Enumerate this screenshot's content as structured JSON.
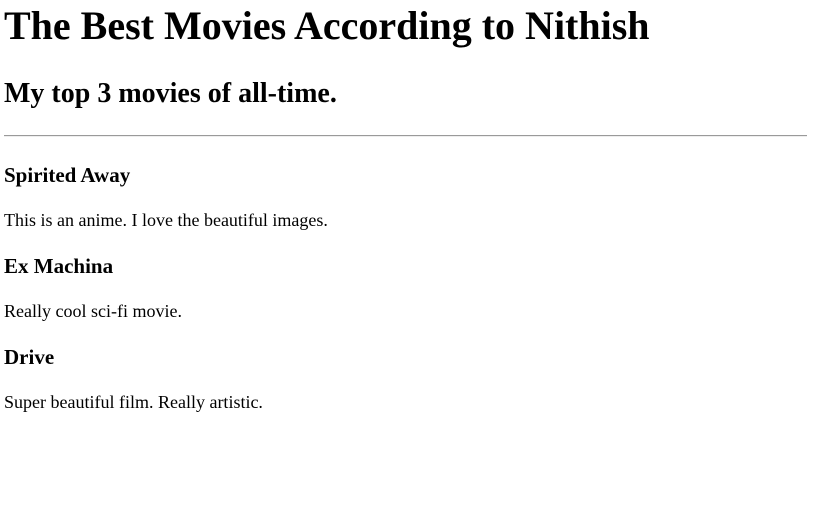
{
  "page": {
    "title": "The Best Movies According to Nithish",
    "subtitle": "My top 3 movies of all-time."
  },
  "movies": [
    {
      "title": "Spirited Away",
      "description": "This is an anime. I love the beautiful images."
    },
    {
      "title": "Ex Machina",
      "description": "Really cool sci-fi movie."
    },
    {
      "title": "Drive",
      "description": "Super beautiful film. Really artistic."
    }
  ]
}
